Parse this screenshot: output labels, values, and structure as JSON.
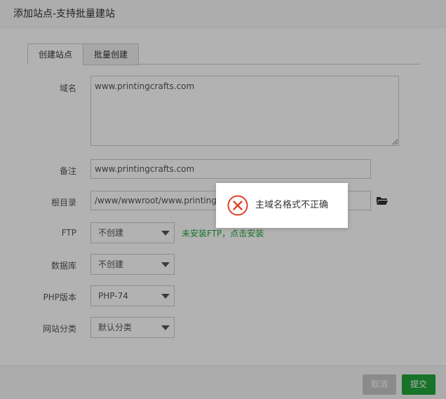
{
  "dialog": {
    "title": "添加站点-支持批量建站"
  },
  "tabs": [
    {
      "label": "创建站点",
      "active": true
    },
    {
      "label": "批量创建",
      "active": false
    }
  ],
  "form": {
    "domain": {
      "label": "域名",
      "value": "www.printingcrafts.com"
    },
    "remark": {
      "label": "备注",
      "value": "www.printingcrafts.com"
    },
    "root": {
      "label": "根目录",
      "value": "/www/wwwroot/www.printingcrafts.com"
    },
    "ftp": {
      "label": "FTP",
      "selected": "不创建",
      "hint": "未安装FTP，点击安装"
    },
    "database": {
      "label": "数据库",
      "selected": "不创建"
    },
    "php": {
      "label": "PHP版本",
      "selected": "PHP-74"
    },
    "category": {
      "label": "网站分类",
      "selected": "默认分类"
    }
  },
  "footer": {
    "cancel_label": "取消",
    "submit_label": "提交"
  },
  "toast": {
    "message": "主域名格式不正确",
    "icon": "error-circle-icon"
  },
  "colors": {
    "accent": "#20a53a",
    "error": "#e0412b"
  }
}
